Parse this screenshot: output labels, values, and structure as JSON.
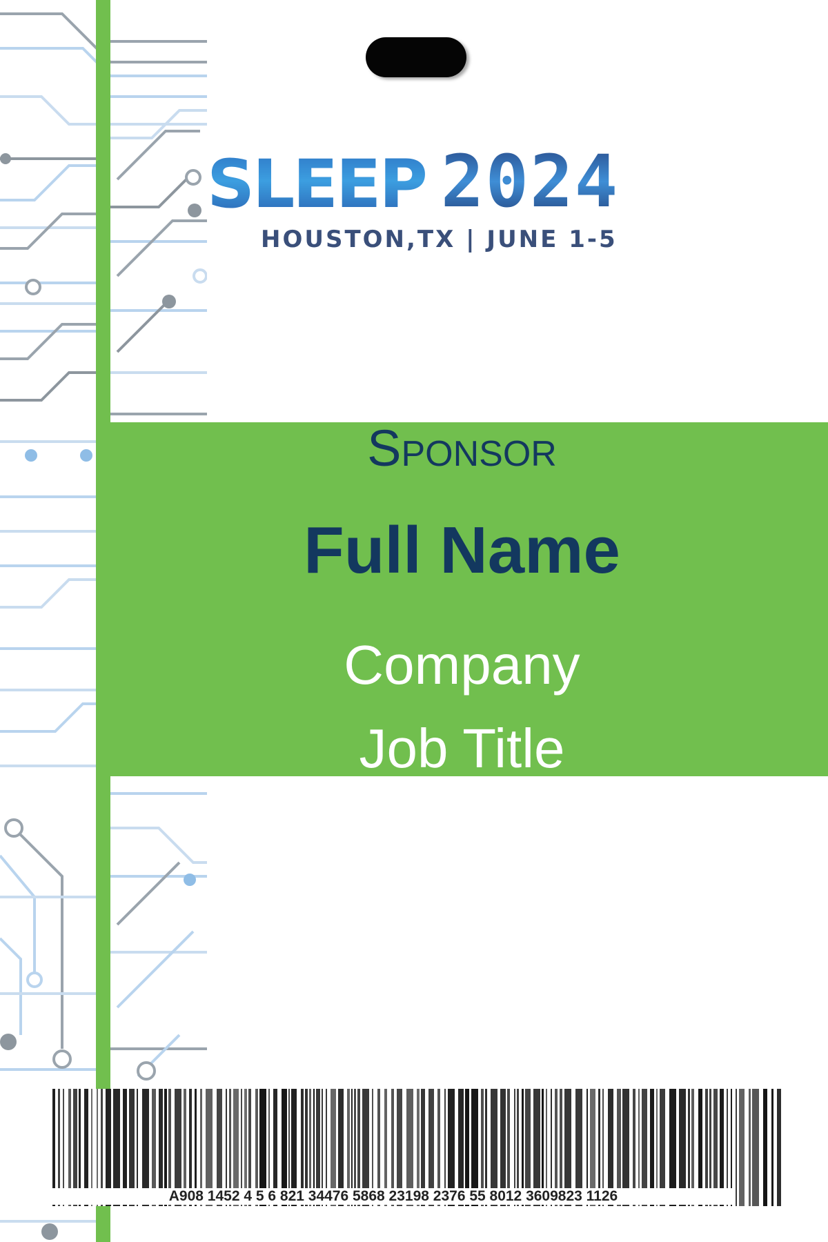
{
  "logo": {
    "word": "SLEEP",
    "year": "2024",
    "subtitle": "HOUSTON,TX | JUNE 1-5"
  },
  "badge": {
    "role": "Sponsor",
    "full_name": "Full Name",
    "company": "Company",
    "job_title": "Job Title"
  },
  "barcode": {
    "number": "A908 1452 4 5 6 821 34476 5868 23198 2376 55 8012 3609823 1126"
  },
  "colors": {
    "accent_green": "#71bf4e",
    "navy_text": "#13385f",
    "logo_blue": "#3c9ee0"
  }
}
